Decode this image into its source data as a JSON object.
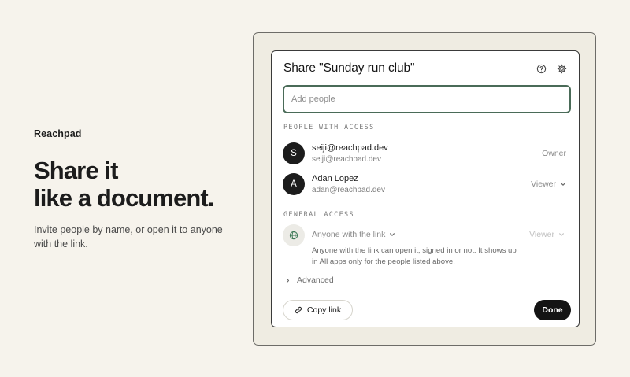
{
  "hero": {
    "brand": "Reachpad",
    "headline_line1": "Share it",
    "headline_line2": "like a document.",
    "subtext": "Invite people by name, or open it to anyone with the link."
  },
  "dialog": {
    "title": "Share \"Sunday run club\"",
    "help_icon": "help-circle-icon",
    "settings_icon": "gear-icon",
    "add_people_placeholder": "Add people",
    "people_section_label": "PEOPLE WITH ACCESS",
    "people": [
      {
        "initial": "S",
        "name": "seiji@reachpad.dev",
        "email": "seiji@reachpad.dev",
        "role": "Owner"
      },
      {
        "initial": "A",
        "name": "Adan Lopez",
        "email": "adan@reachpad.dev",
        "role": "Viewer"
      }
    ],
    "general_section_label": "GENERAL ACCESS",
    "general_access": {
      "icon": "globe-icon",
      "option": "Anyone with the link",
      "role": "Viewer",
      "description": "Anyone with the link can open it, signed in or not. It shows up in All apps only for the people listed above."
    },
    "advanced_label": "Advanced",
    "copy_link_label": "Copy link",
    "done_label": "Done"
  },
  "colors": {
    "page_bg": "#f6f3ec",
    "frame_bg": "#efece2",
    "input_focus_border": "#4a6b58",
    "avatar_bg": "#1c1c1c",
    "globe_icon": "#3e7a58",
    "done_bg": "#141414"
  }
}
